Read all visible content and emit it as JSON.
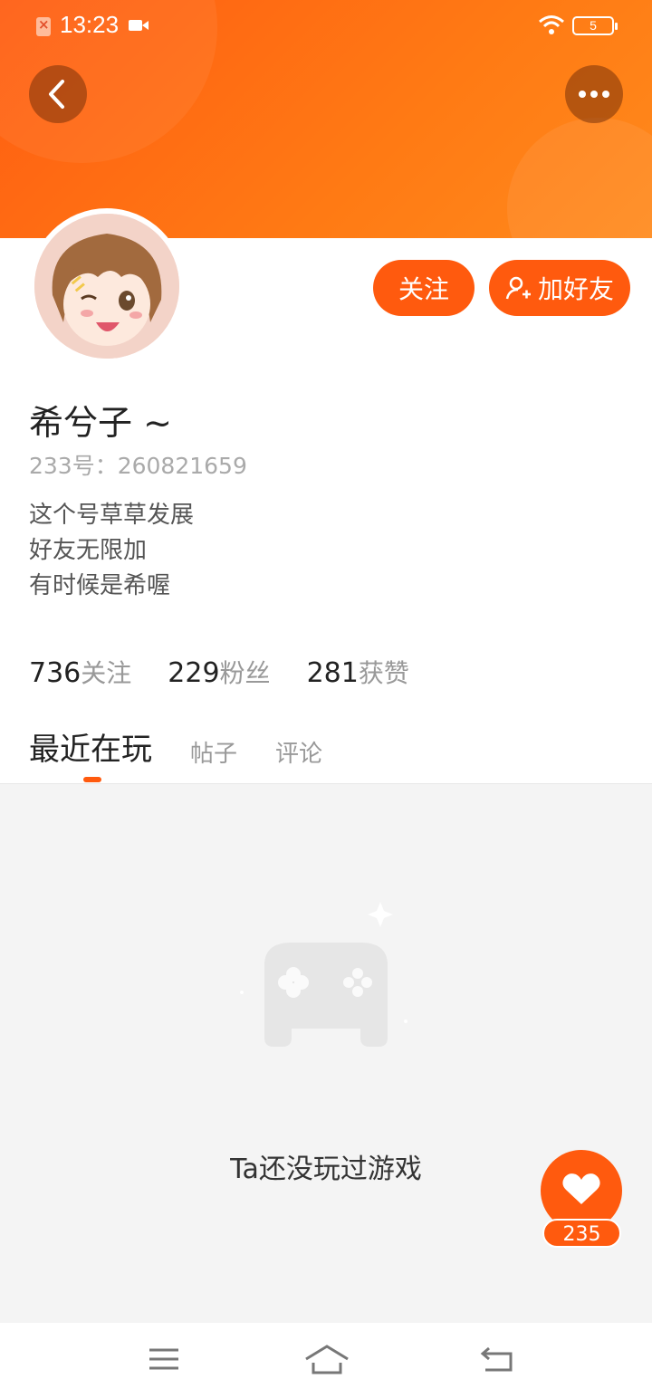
{
  "status_bar": {
    "time": "13:23",
    "battery": "5"
  },
  "profile": {
    "username": "希兮子 ~",
    "id_text": "233号：260821659",
    "bio_lines": [
      "这个号草草发展",
      "好友无限加",
      "有时候是希喔"
    ]
  },
  "actions": {
    "follow_label": "关注",
    "add_friend_label": "加好友"
  },
  "stats": [
    {
      "num": "736",
      "label": "关注"
    },
    {
      "num": "229",
      "label": "粉丝"
    },
    {
      "num": "281",
      "label": "获赞"
    }
  ],
  "tabs": [
    {
      "label": "最近在玩",
      "active": true
    },
    {
      "label": "帖子",
      "active": false
    },
    {
      "label": "评论",
      "active": false
    }
  ],
  "empty_state": {
    "message": "Ta还没玩过游戏"
  },
  "like": {
    "count": "235"
  },
  "icons": [
    "back-icon",
    "more-icon",
    "add-user-icon",
    "gamepad-icon",
    "heart-icon",
    "menu-icon",
    "home-icon",
    "return-icon"
  ],
  "colors": {
    "accent": "#ff5a0e",
    "banner": "#ff6a12"
  }
}
